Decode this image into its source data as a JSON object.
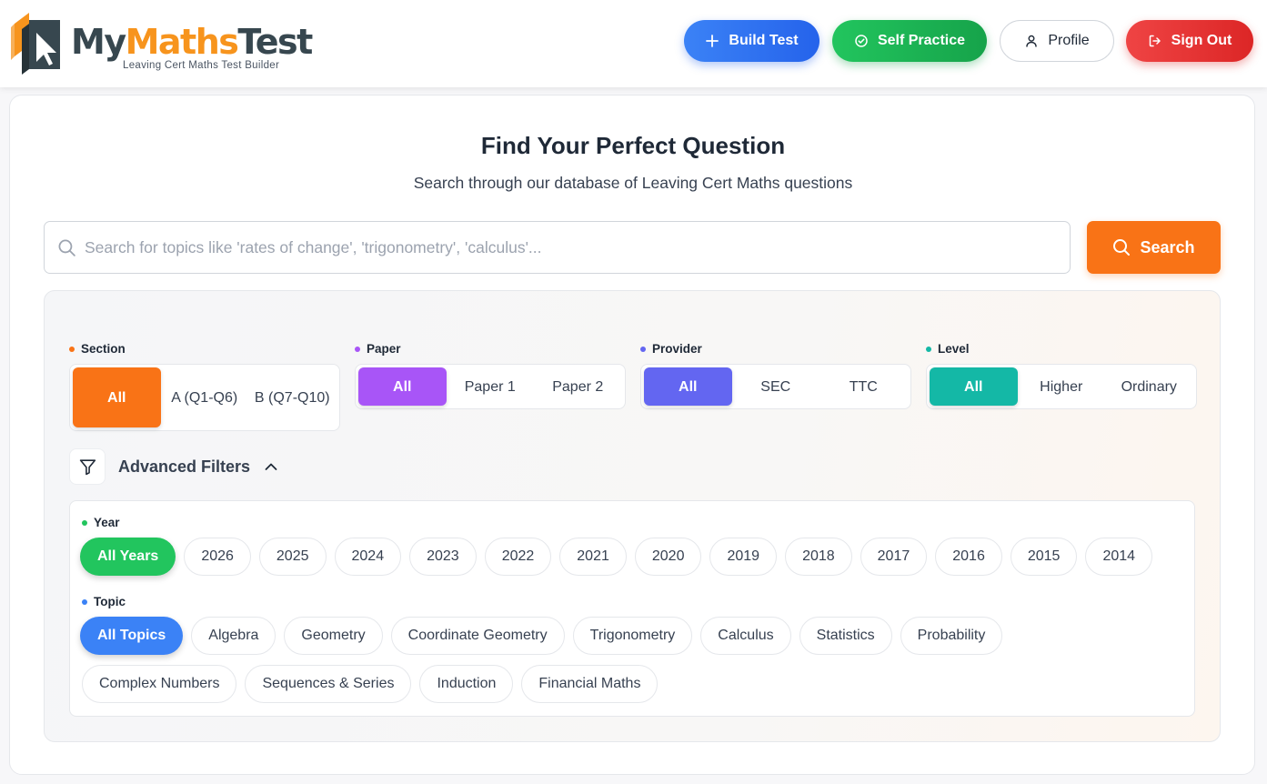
{
  "brand": {
    "name_part1": "My",
    "name_part2": "Maths",
    "name_part3": "Test",
    "tagline": "Leaving Cert Maths Test Builder"
  },
  "header": {
    "build_test": "Build Test",
    "self_practice": "Self Practice",
    "profile": "Profile",
    "sign_out": "Sign Out"
  },
  "main": {
    "title": "Find Your Perfect Question",
    "subtitle": "Search through our database of Leaving Cert Maths questions",
    "search_placeholder": "Search for topics like 'rates of change', 'trigonometry', 'calculus'...",
    "search_button": "Search"
  },
  "filters": {
    "groups": [
      {
        "label": "Section",
        "color": "#f97316",
        "options": [
          "All",
          "A (Q1-Q6)",
          "B (Q7-Q10)"
        ],
        "selected": "All"
      },
      {
        "label": "Paper",
        "color": "#a855f7",
        "options": [
          "All",
          "Paper 1",
          "Paper 2"
        ],
        "selected": "All"
      },
      {
        "label": "Provider",
        "color": "#6366f1",
        "options": [
          "All",
          "SEC",
          "TTC"
        ],
        "selected": "All"
      },
      {
        "label": "Level",
        "color": "#14b8a6",
        "options": [
          "All",
          "Higher",
          "Ordinary"
        ],
        "selected": "All"
      }
    ],
    "advanced_label": "Advanced Filters",
    "year": {
      "label": "Year",
      "color": "#22c55e",
      "options": [
        "All Years",
        "2026",
        "2025",
        "2024",
        "2023",
        "2022",
        "2021",
        "2020",
        "2019",
        "2018",
        "2017",
        "2016",
        "2015",
        "2014"
      ],
      "selected": "All Years"
    },
    "topic": {
      "label": "Topic",
      "color": "#3b82f6",
      "row1": [
        "All Topics",
        "Algebra",
        "Geometry",
        "Coordinate Geometry",
        "Trigonometry",
        "Calculus",
        "Statistics",
        "Probability"
      ],
      "row2": [
        "Complex Numbers",
        "Sequences & Series",
        "Induction",
        "Financial Maths"
      ],
      "selected": "All Topics"
    }
  }
}
